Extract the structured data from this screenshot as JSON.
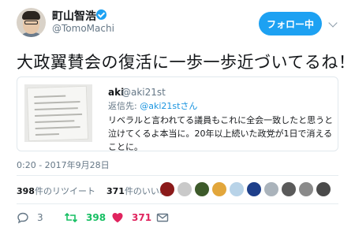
{
  "user": {
    "display_name": "町山智浩",
    "handle": "@TomoMachi",
    "verified_icon": "verified-badge-icon",
    "follow_label": "フォロー中"
  },
  "tweet": {
    "text": "大政翼賛会の復活に一歩一歩近づいてるね！"
  },
  "quoted": {
    "name": "aki",
    "handle": "@aki21st",
    "reply_prefix": "返信先:",
    "reply_handle": "@aki21stさん",
    "body": "リベラルと言われてる議員もこれに全会一致したと思うと泣けてくるよ本当に。20年以上続いた政党が1日で消えることに。"
  },
  "meta": {
    "timestamp": "0:20 - 2017年9月28日"
  },
  "stats": {
    "retweets_count": "398",
    "retweets_label": "件のリツイート",
    "likes_count": "371",
    "likes_label": "件のいいね"
  },
  "actions": {
    "reply_count": "3",
    "retweet_count": "398",
    "like_count": "371"
  },
  "colors": {
    "brand": "#1da1f2",
    "retweet": "#17bf63",
    "like": "#e0245e",
    "muted": "#657786"
  }
}
